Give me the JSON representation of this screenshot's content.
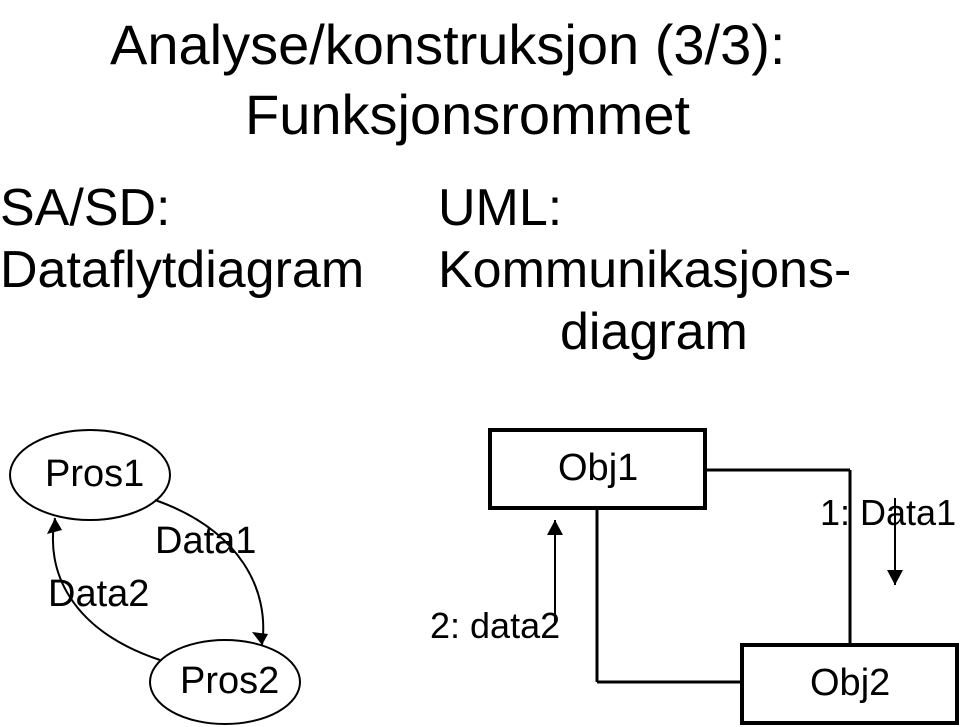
{
  "title": "Analyse/konstruksjon (3/3):",
  "subtitle": "Funksjonsrommet",
  "left_column": {
    "heading1": "SA/SD:",
    "heading2": "Dataflytdiagram",
    "process1": "Pros1",
    "process2": "Pros2",
    "flow1": "Data1",
    "flow2": "Data2"
  },
  "right_column": {
    "heading1": "UML:",
    "heading2": "Kommunikasjons-",
    "heading3": "diagram",
    "object1": "Obj1",
    "object2": "Obj2",
    "message1": "1: Data1",
    "message2": "2: data2"
  }
}
